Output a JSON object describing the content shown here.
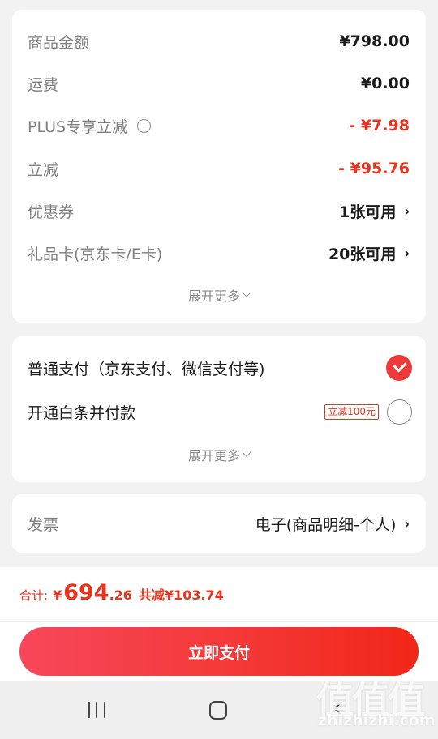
{
  "summary": {
    "rows": [
      {
        "label": "商品金额",
        "value": "¥798.00"
      },
      {
        "label": "运费",
        "value": "¥0.00"
      },
      {
        "label": "PLUS专享立减",
        "value": "- ¥7.98"
      },
      {
        "label": "立减",
        "value": "- ¥95.76"
      },
      {
        "label": "优惠券",
        "value": "1张可用"
      },
      {
        "label": "礼品卡(京东卡/E卡)",
        "value": "20张可用"
      }
    ],
    "expand_label": "展开更多"
  },
  "payment": {
    "options": [
      {
        "label": "普通支付（京东支付、微信支付等)",
        "selected": true
      },
      {
        "label": "开通白条并付款",
        "promo": "立减100元",
        "selected": false
      }
    ],
    "expand_label": "展开更多"
  },
  "invoice": {
    "label": "发票",
    "value": "电子(商品明细-个人)"
  },
  "total": {
    "label": "合计:",
    "currency": "¥",
    "amount_int": "694",
    "amount_dec": ".26",
    "saving": "共减¥103.74"
  },
  "pay_button_label": "立即支付",
  "icons": {
    "info": "info-icon",
    "chevron": "chevron-right-icon",
    "check": "checkmark-icon"
  },
  "colors": {
    "accent": "#e8341c",
    "button_start": "#f8475a",
    "button_end": "#f22618"
  },
  "watermark": {
    "logo": "值值值",
    "text": "zhizhizhi.com"
  }
}
